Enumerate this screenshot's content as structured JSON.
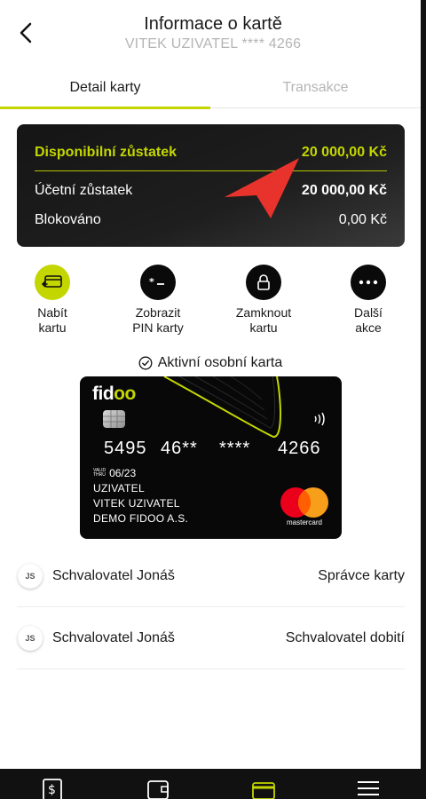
{
  "header": {
    "title": "Informace o kartě",
    "subtitle": "VITEK UZIVATEL **** 4266"
  },
  "tabs": [
    {
      "label": "Detail karty",
      "active": true
    },
    {
      "label": "Transakce",
      "active": false
    }
  ],
  "balance": {
    "available_label": "Disponibilní zůstatek",
    "available_value": "20 000,00 Kč",
    "account_label": "Účetní zůstatek",
    "account_value": "20 000,00 Kč",
    "blocked_label": "Blokováno",
    "blocked_value": "0,00 Kč"
  },
  "actions": [
    {
      "line1": "Nabít",
      "line2": "kartu",
      "icon": "card-topup-icon"
    },
    {
      "line1": "Zobrazit",
      "line2": "PIN karty",
      "icon": "pin-icon"
    },
    {
      "line1": "Zamknout",
      "line2": "kartu",
      "icon": "lock-icon"
    },
    {
      "line1": "Další",
      "line2": "akce",
      "icon": "more-icon"
    }
  ],
  "card_status": "Aktivní osobní karta",
  "card": {
    "brand": "fidoo",
    "number_groups": [
      "5495",
      "46**",
      "****",
      "4266"
    ],
    "valid_thru_label": [
      "VALID",
      "THRU"
    ],
    "valid_thru": "06/23",
    "holder_lines": [
      "UZIVATEL",
      "VITEK UZIVATEL",
      "DEMO FIDOO A.S."
    ],
    "network": "mastercard"
  },
  "roles": [
    {
      "initials": "JS",
      "name": "Schvalovatel Jonáš",
      "role": "Správce karty"
    },
    {
      "initials": "JS",
      "name": "Schvalovatel Jonáš",
      "role": "Schvalovatel dobití"
    }
  ],
  "colors": {
    "accent": "#c4d600",
    "dark": "#111111",
    "pointer": "#e8332c"
  },
  "bottom_nav": [
    {
      "icon": "dollar-document-icon",
      "active": false
    },
    {
      "icon": "wallet-icon",
      "active": false
    },
    {
      "icon": "card-icon",
      "active": true
    },
    {
      "icon": "menu-icon",
      "active": false
    }
  ]
}
